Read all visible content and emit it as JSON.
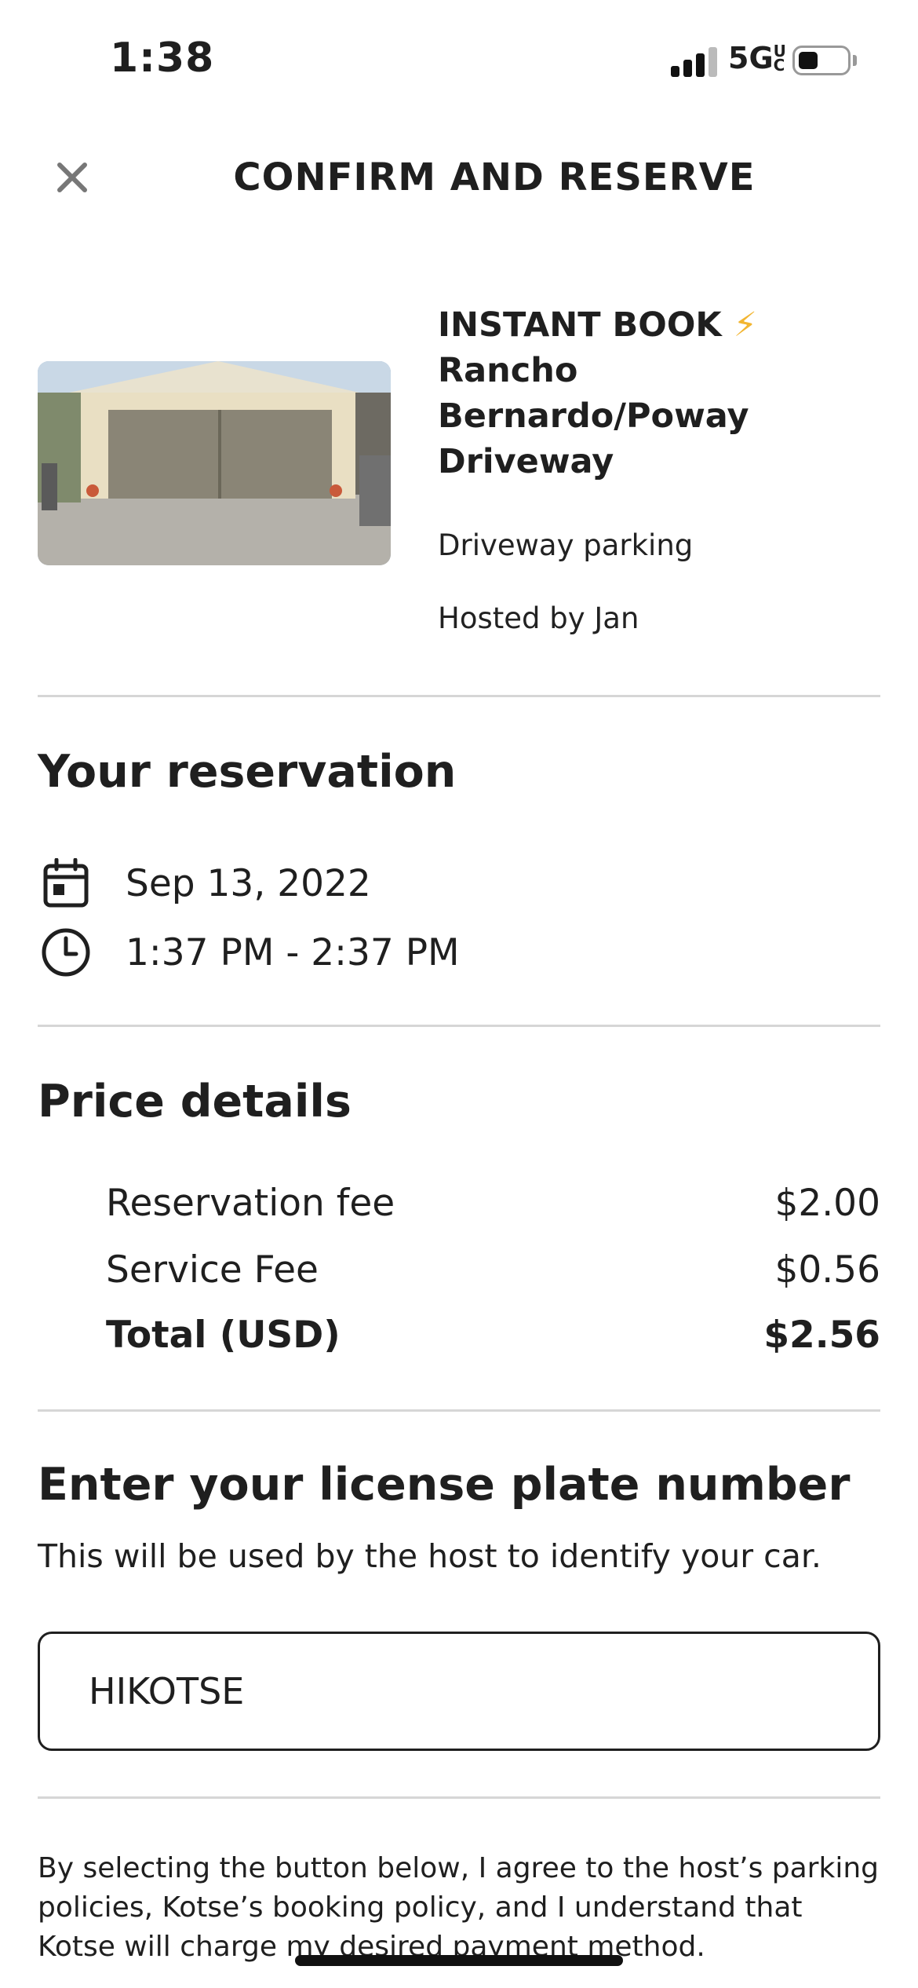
{
  "status_bar": {
    "time": "1:38",
    "network": "5G",
    "network_suffix": "UC"
  },
  "header": {
    "title": "CONFIRM AND RESERVE",
    "close_icon": "close-icon"
  },
  "listing": {
    "title_prefix": "INSTANT BOOK",
    "bolt": "⚡",
    "title_rest": "Rancho Bernardo/Poway Driveway",
    "type": "Driveway parking",
    "host": "Hosted by Jan"
  },
  "reservation": {
    "heading": "Your reservation",
    "date": "Sep 13, 2022",
    "time_range": "1:37 PM - 2:37 PM"
  },
  "price": {
    "heading": "Price details",
    "rows": [
      {
        "label": "Reservation fee",
        "amount": "$2.00"
      },
      {
        "label": "Service Fee",
        "amount": "$0.56"
      },
      {
        "label": "Total (USD)",
        "amount": "$2.56"
      }
    ]
  },
  "license": {
    "heading": "Enter your license plate number",
    "subtext": "This will be used by the host to identify your car.",
    "value": "HIKOTSE"
  },
  "policy_text": "By selecting the button below, I agree to the host’s parking policies, Kotse’s booking policy, and I understand that Kotse will charge my desired payment method.",
  "colors": {
    "accent_bolt": "#f2b531",
    "text": "#1f1f1f",
    "divider": "#d6d6d6"
  }
}
